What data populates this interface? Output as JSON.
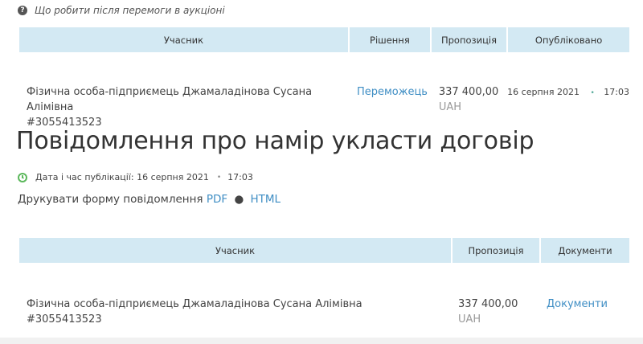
{
  "help": {
    "icon": "question-circle-icon",
    "text": "Що робити після перемоги в аукціоні"
  },
  "winner_table": {
    "headers": [
      "Учасник",
      "Рішення",
      "Пропозиція",
      "Опубліковано"
    ],
    "row": {
      "participant_line1": "Фізична особа-підприємець Джамаладінова Сусана Алімівна",
      "participant_line2": "#3055413523",
      "decision": "Переможець",
      "amount": "337 400,00",
      "currency": "UAH",
      "published_date": "16 серпня 2021",
      "published_time": "17:03"
    }
  },
  "notice": {
    "title": "Повідомлення про намір укласти договір",
    "pub_label": "Дата і час публікації: 16 серпня 2021",
    "pub_time": "17:03",
    "print_label": "Друкувати форму повідомлення",
    "pdf_link": "PDF",
    "separator": "●",
    "html_link": "HTML"
  },
  "notice_table": {
    "headers": [
      "Учасник",
      "Пропозиція",
      "Документи"
    ],
    "row": {
      "participant_line1": "Фізична особа-підприємець Джамаладінова Сусана Алімівна",
      "participant_line2": "#3055413523",
      "amount": "337 400,00",
      "currency": "UAH",
      "documents": "Документи"
    }
  },
  "colors": {
    "header_bg": "#d3e9f3",
    "link": "#3f8ec4",
    "clock": "#5cb85c"
  }
}
